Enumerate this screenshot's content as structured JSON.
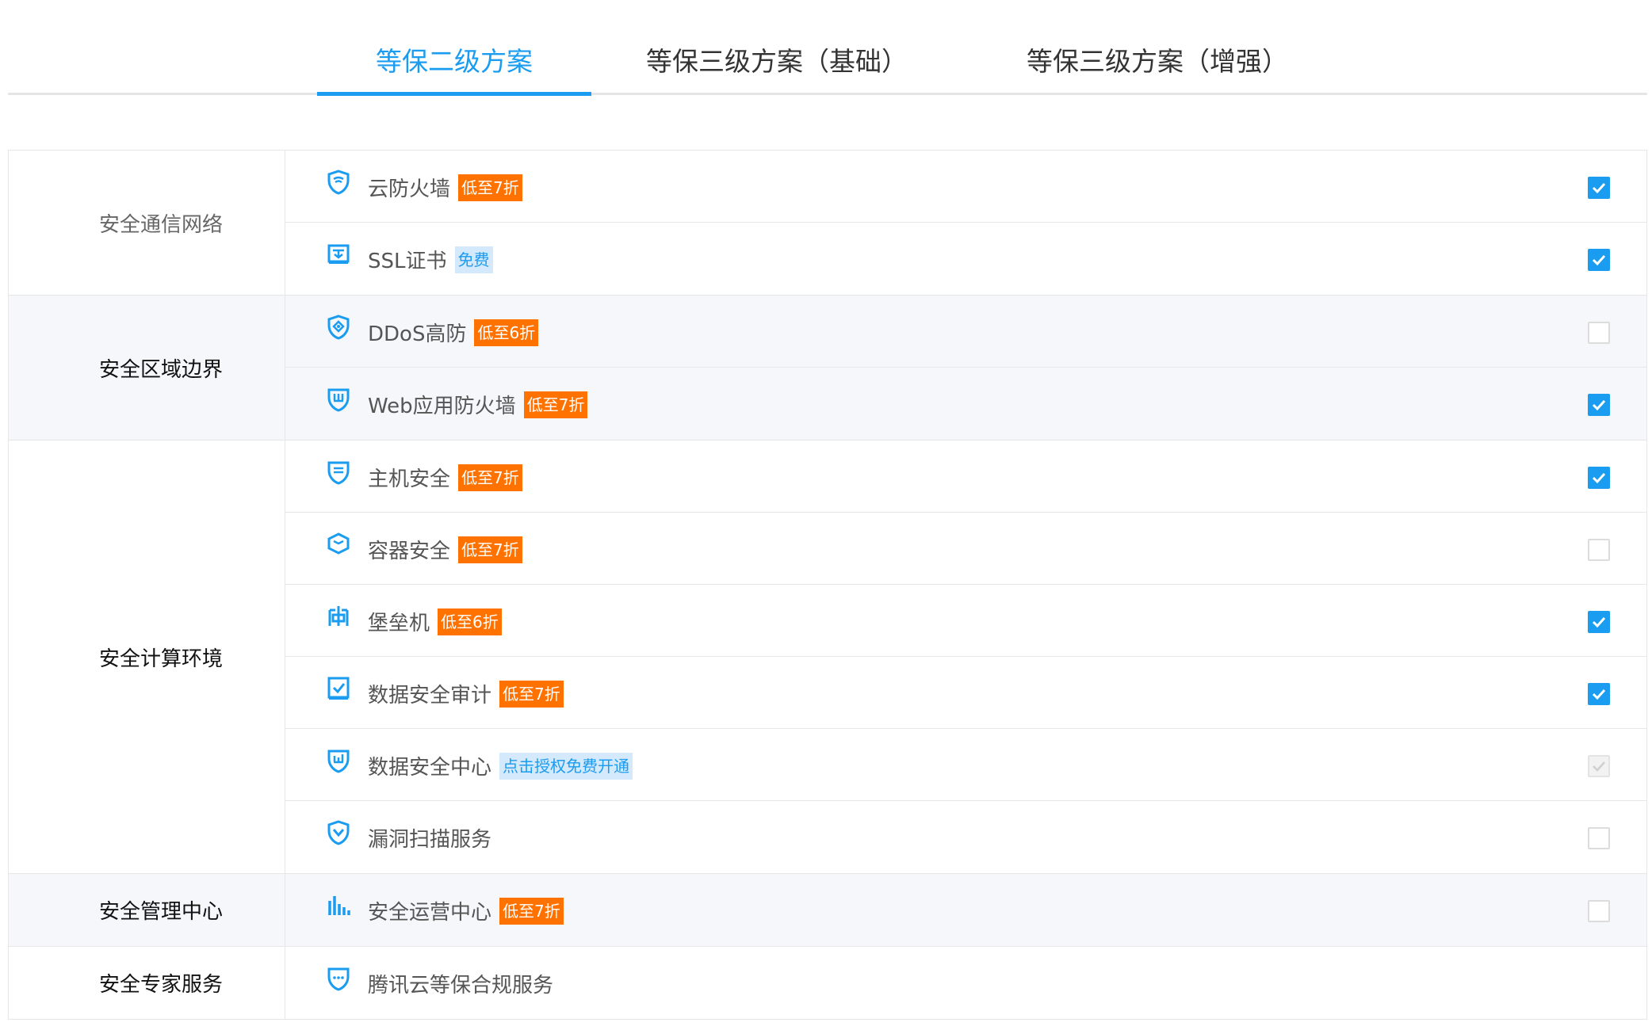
{
  "tabs": [
    {
      "label": "等保二级方案",
      "active": true
    },
    {
      "label": "等保三级方案（基础）",
      "active": false
    },
    {
      "label": "等保三级方案（增强）",
      "active": false
    }
  ],
  "colors": {
    "accent": "#1a9cf0",
    "badge_orange": "#ff7200",
    "badge_blue_bg": "#d4e9fb"
  },
  "groups": [
    {
      "label": "安全通信网络",
      "items": [
        {
          "icon": "shield-wifi-icon",
          "name": "云防火墙",
          "badge": "低至7折",
          "badge_type": "orange",
          "check": "checked"
        },
        {
          "icon": "certificate-icon",
          "name": "SSL证书",
          "badge": "免费",
          "badge_type": "blue",
          "check": "checked"
        }
      ]
    },
    {
      "label": "安全区域边界",
      "items": [
        {
          "icon": "shield-target-icon",
          "name": "DDoS高防",
          "badge": "低至6折",
          "badge_type": "orange",
          "check": "unchecked"
        },
        {
          "icon": "shield-wall-icon",
          "name": "Web应用防火墙",
          "badge": "低至7折",
          "badge_type": "orange",
          "check": "checked"
        }
      ]
    },
    {
      "label": "安全计算环境",
      "items": [
        {
          "icon": "shield-host-icon",
          "name": "主机安全",
          "badge": "低至7折",
          "badge_type": "orange",
          "check": "checked"
        },
        {
          "icon": "container-cube-icon",
          "name": "容器安全",
          "badge": "低至7折",
          "badge_type": "orange",
          "check": "unchecked"
        },
        {
          "icon": "bastion-fort-icon",
          "name": "堡垒机",
          "badge": "低至6折",
          "badge_type": "orange",
          "check": "checked"
        },
        {
          "icon": "audit-check-icon",
          "name": "数据安全审计",
          "badge": "低至7折",
          "badge_type": "orange",
          "check": "checked"
        },
        {
          "icon": "shield-data-icon",
          "name": "数据安全中心",
          "badge": "点击授权免费开通",
          "badge_type": "blue",
          "check": "disabled"
        },
        {
          "icon": "shield-scan-icon",
          "name": "漏洞扫描服务",
          "badge": "",
          "badge_type": "",
          "check": "unchecked"
        }
      ]
    },
    {
      "label": "安全管理中心",
      "items": [
        {
          "icon": "bar-chart-icon",
          "name": "安全运营中心",
          "badge": "低至7折",
          "badge_type": "orange",
          "check": "unchecked"
        }
      ]
    },
    {
      "label": "安全专家服务",
      "items": [
        {
          "icon": "shield-compliance-icon",
          "name": "腾讯云等保合规服务",
          "badge": "",
          "badge_type": "",
          "check": "none"
        }
      ]
    }
  ]
}
